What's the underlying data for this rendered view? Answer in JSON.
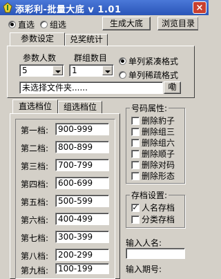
{
  "window": {
    "title": "添彩利-批量大底 v 1.01",
    "close_glyph": "×"
  },
  "mode": {
    "options": [
      "直选",
      "组选"
    ],
    "selected": 0
  },
  "top_buttons": [
    "生成大底",
    "浏览目录"
  ],
  "tabs": [
    "参数设定",
    "兑奖统计"
  ],
  "params": {
    "param_count_label": "参数人数",
    "param_count_value": "5",
    "group_count_label": "群组数目",
    "group_count_value": "1",
    "format_options": [
      "单列紧凑格式",
      "单列稀疏格式"
    ],
    "format_selected": 0,
    "folder_text": "未选择文件夹......",
    "folder_button": "嘞"
  },
  "level_tabs": [
    "直选档位",
    "组选档位"
  ],
  "levels": [
    {
      "label": "第一档:",
      "value": "900-999"
    },
    {
      "label": "第二档:",
      "value": "800-899"
    },
    {
      "label": "第三档:",
      "value": "700-799"
    },
    {
      "label": "第四档:",
      "value": "600-699"
    },
    {
      "label": "第五档:",
      "value": "500-599"
    },
    {
      "label": "第六档:",
      "value": "400-499"
    },
    {
      "label": "第七档:",
      "value": "300-399"
    },
    {
      "label": "第八档:",
      "value": "200-299"
    },
    {
      "label": "第九档:",
      "value": "100-199"
    }
  ],
  "attributes": {
    "label": "号码属性:",
    "items": [
      "删除豹子",
      "删除组三",
      "删除组六",
      "删除顺子",
      "删除对码",
      "删除形态"
    ]
  },
  "storage": {
    "label": "存档设置:",
    "items": [
      {
        "label": "人名存档",
        "checked": true
      },
      {
        "label": "分类存档",
        "checked": false
      }
    ]
  },
  "name_input_label": "输入人名:",
  "period_input_label": "输入期号:"
}
